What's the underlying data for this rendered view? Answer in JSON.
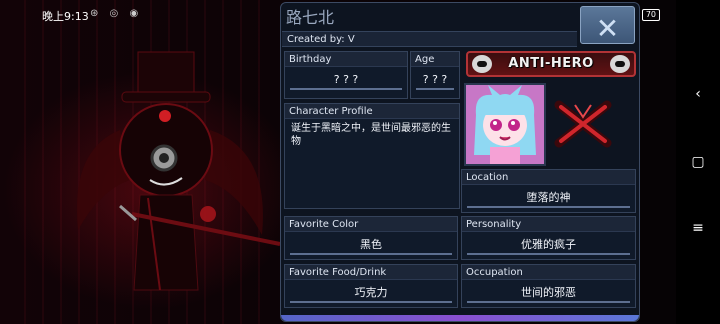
{
  "status_bar": {
    "time": "晚上9:13",
    "battery": "70"
  },
  "profile": {
    "name": "路七北",
    "created_by": "Created by: V",
    "birthday": {
      "label": "Birthday",
      "value": "? ? ?"
    },
    "age": {
      "label": "Age",
      "value": "? ? ?"
    },
    "badge": "ANTI-HERO",
    "character_profile": {
      "label": "Character Profile",
      "value": "诞生于黑暗之中，是世间最邪恶的生物"
    },
    "location": {
      "label": "Location",
      "value": "堕落的神"
    },
    "favorite_color": {
      "label": "Favorite Color",
      "value": "黑色"
    },
    "personality": {
      "label": "Personality",
      "value": "优雅的疯子"
    },
    "favorite_food": {
      "label": "Favorite Food/Drink",
      "value": "巧克力"
    },
    "occupation": {
      "label": "Occupation",
      "value": "世间的邪恶"
    }
  },
  "colors": {
    "panel_bg": "#0d1420",
    "accent": "#5d6f90",
    "badge_red": "#b23336"
  },
  "icons": [
    "close-icon",
    "skull-icon",
    "crossed-swords-icon",
    "back-icon",
    "home-icon",
    "menu-icon"
  ]
}
